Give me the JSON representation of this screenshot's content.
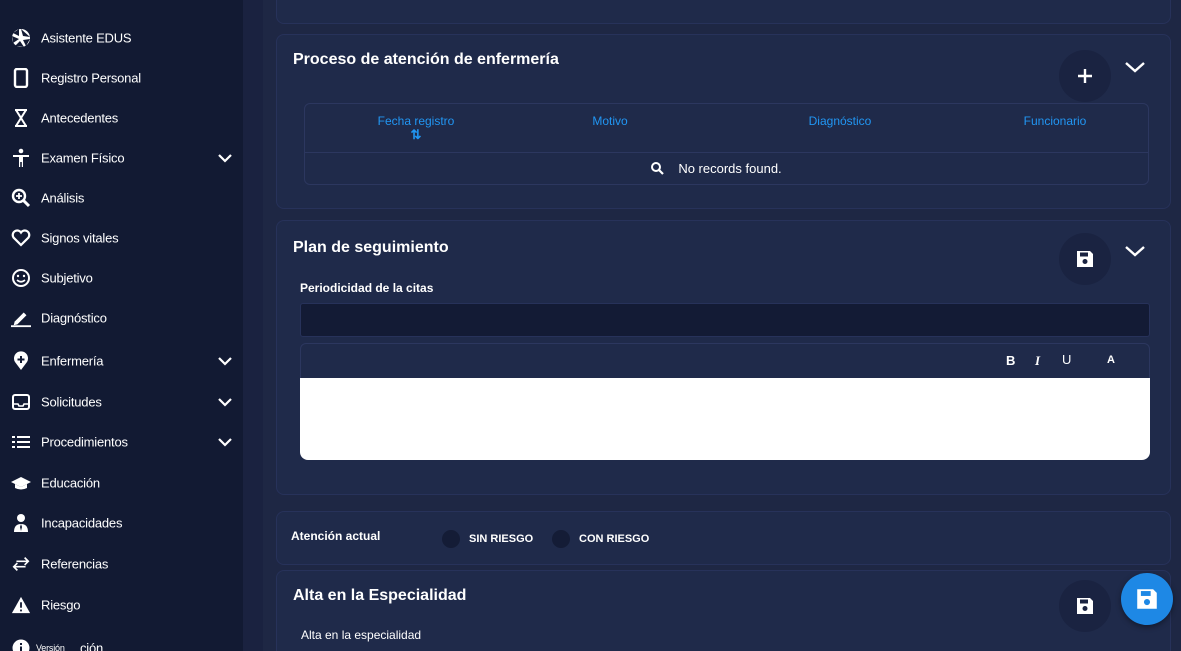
{
  "sidebar": {
    "items": [
      {
        "label": "Asistente EDUS",
        "icon": "aperture-icon"
      },
      {
        "label": "Registro Personal",
        "icon": "tablet-icon"
      },
      {
        "label": "Antecedentes",
        "icon": "hourglass-icon"
      },
      {
        "label": "Examen Físico",
        "icon": "person-icon"
      },
      {
        "label": "Análisis",
        "icon": "search-plus-icon"
      },
      {
        "label": "Signos vitales",
        "icon": "heart-icon"
      },
      {
        "label": "Subjetivo",
        "icon": "smile-icon"
      },
      {
        "label": "Diagnóstico",
        "icon": "pencil-icon"
      },
      {
        "label": "Enfermería",
        "icon": "map-marker-plus-icon"
      },
      {
        "label": "Solicitudes",
        "icon": "inbox-icon"
      },
      {
        "label": "Procedimientos",
        "icon": "list-icon"
      },
      {
        "label": "Educación",
        "icon": "graduation-cap-icon"
      },
      {
        "label": "Incapacidades",
        "icon": "user-tie-icon"
      },
      {
        "label": "Referencias",
        "icon": "exchange-icon"
      },
      {
        "label": "Riesgo",
        "icon": "warning-icon"
      },
      {
        "label": "Versión",
        "icon": "info-icon"
      }
    ],
    "version_suffix": "ción"
  },
  "nursing_process": {
    "title": "Proceso de atención de enfermería",
    "columns": [
      "Fecha registro",
      "Motivo",
      "Diagnóstico",
      "Funcionario"
    ],
    "sort_glyph": "⇅",
    "empty_message": "No records found."
  },
  "follow_up": {
    "title": "Plan de seguimiento",
    "field_label": "Periodicidad de la citas",
    "toolbar": {
      "bold": "B",
      "italic": "I",
      "underline": "U",
      "font": "A"
    }
  },
  "current_care": {
    "label": "Atención actual",
    "options": [
      "SIN RIESGO",
      "CON RIESGO"
    ]
  },
  "discharge": {
    "title": "Alta en la Especialidad",
    "field_label": "Alta en la especialidad"
  },
  "colors": {
    "accent": "#2196f3",
    "fab": "#1e88e5",
    "sidebar_bg": "#121a33",
    "card_bg": "#1f2a4a"
  }
}
